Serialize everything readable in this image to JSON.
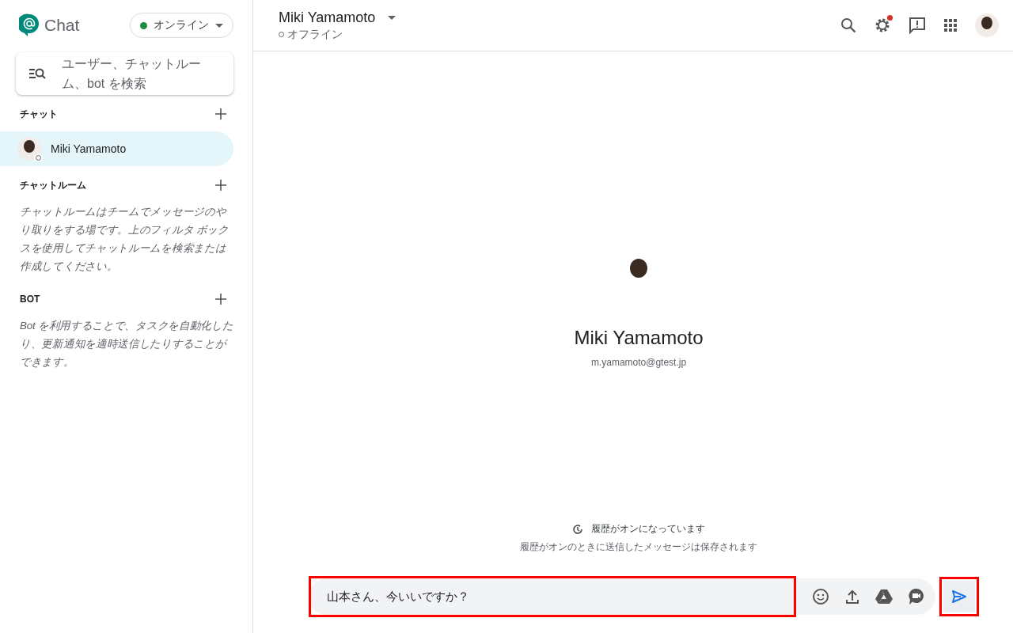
{
  "app": {
    "name": "Chat"
  },
  "status": {
    "label": "オンライン",
    "online": true
  },
  "search": {
    "placeholder": "ユーザー、チャットルーム、bot を検索"
  },
  "sections": [
    {
      "title": "チャット",
      "items": [
        {
          "name": "Miki Yamamoto",
          "selected": true,
          "online": false
        }
      ]
    },
    {
      "title": "チャットルーム",
      "description": "チャットルームはチームでメッセージのやり取りをする場です。上のフィルタ ボックスを使用してチャットルームを検索または作成してください。"
    },
    {
      "title": "BOT",
      "description": "Bot を利用することで、タスクを自動化したり、更新通知を適時送信したりすることができます。"
    }
  ],
  "header": {
    "name": "Miki Yamamoto",
    "status": "オフライン",
    "online": false,
    "settings_notice": true
  },
  "profile": {
    "name": "Miki Yamamoto",
    "email": "m.yamamoto@gtest.jp"
  },
  "history": {
    "title": "履歴がオンになっています",
    "note": "履歴がオンのときに送信したメッセージは保存されます"
  },
  "composer": {
    "value": "山本さん、今いいですか？",
    "highlighted": true
  },
  "send": {
    "highlighted": true
  }
}
